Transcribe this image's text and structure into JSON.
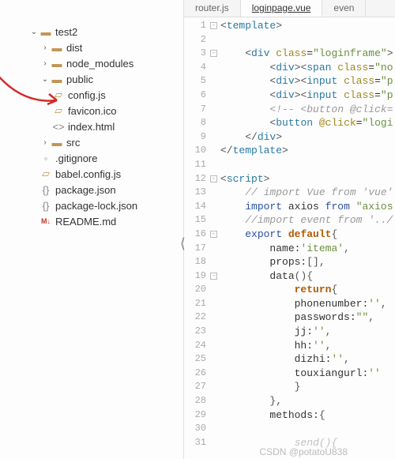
{
  "sidebar": {
    "root": "test2",
    "items": [
      {
        "label": "dist",
        "kind": "folder-closed",
        "twist": "›"
      },
      {
        "label": "node_modules",
        "kind": "folder-closed",
        "twist": "›"
      },
      {
        "label": "public",
        "kind": "folder-open",
        "twist": "⌄"
      }
    ],
    "public_children": [
      {
        "label": "config.js",
        "kind": "file-js"
      },
      {
        "label": "favicon.ico",
        "kind": "file-generic"
      },
      {
        "label": "index.html",
        "kind": "file-generic"
      }
    ],
    "after_public": [
      {
        "label": "src",
        "kind": "folder-closed",
        "twist": "›"
      }
    ],
    "root_files": [
      {
        "label": ".gitignore",
        "kind": "file-generic"
      },
      {
        "label": "babel.config.js",
        "kind": "file-js"
      },
      {
        "label": "package.json",
        "kind": "file-generic"
      },
      {
        "label": "package-lock.json",
        "kind": "file-generic"
      },
      {
        "label": "README.md",
        "kind": "file-md"
      }
    ]
  },
  "tabs": [
    {
      "label": "router.js",
      "active": false
    },
    {
      "label": "loginpage.vue",
      "active": true
    },
    {
      "label": "even",
      "active": false
    }
  ],
  "watermark": "CSDN @potatoU838",
  "code_lines": [
    {
      "n": 1,
      "fold": "-",
      "html": "<span class='punct'>&lt;</span><span class='tag'>template</span><span class='punct'>&gt;</span>"
    },
    {
      "n": 2,
      "html": ""
    },
    {
      "n": 3,
      "fold": "-",
      "html": "    <span class='punct'>&lt;</span><span class='tag'>div</span> <span class='attr'>class</span>=<span class='str'>\"loginframe\"</span><span class='punct'>&gt;</span>"
    },
    {
      "n": 4,
      "html": "        <span class='punct'>&lt;</span><span class='tag'>div</span><span class='punct'>&gt;&lt;</span><span class='tag'>span</span> <span class='attr'>class</span>=<span class='str'>\"no</span>"
    },
    {
      "n": 5,
      "html": "        <span class='punct'>&lt;</span><span class='tag'>div</span><span class='punct'>&gt;&lt;</span><span class='tag'>input</span> <span class='attr'>class</span>=<span class='str'>\"p</span>"
    },
    {
      "n": 6,
      "html": "        <span class='punct'>&lt;</span><span class='tag'>div</span><span class='punct'>&gt;&lt;</span><span class='tag'>input</span> <span class='attr'>class</span>=<span class='str'>\"p</span>"
    },
    {
      "n": 7,
      "html": "        <span class='cmt'>&lt;!-- &lt;button @click=</span>"
    },
    {
      "n": 8,
      "html": "        <span class='punct'>&lt;</span><span class='tag'>button</span> <span class='attr'>@click</span>=<span class='str'>\"logi</span>"
    },
    {
      "n": 9,
      "html": "    <span class='punct'>&lt;/</span><span class='tag'>div</span><span class='punct'>&gt;</span>"
    },
    {
      "n": 10,
      "html": "<span class='punct'>&lt;/</span><span class='tag'>template</span><span class='punct'>&gt;</span>"
    },
    {
      "n": 11,
      "html": ""
    },
    {
      "n": 12,
      "fold": "-",
      "html": "<span class='punct'>&lt;</span><span class='tag'>script</span><span class='punct'>&gt;</span>"
    },
    {
      "n": 13,
      "html": "    <span class='cmt'>// import Vue from 'vue'</span>"
    },
    {
      "n": 14,
      "html": "    <span class='kw2'>import</span> <span class='txt'>axios</span> <span class='kw2'>from</span> <span class='str'>\"axios</span>"
    },
    {
      "n": 15,
      "html": "    <span class='cmt'>//import event from '../</span>"
    },
    {
      "n": 16,
      "fold": "-",
      "html": "    <span class='kw2'>export</span> <span class='kw'>default</span><span class='punct'>{</span>"
    },
    {
      "n": 17,
      "html": "        <span class='txt'>name:</span><span class='str'>'itema'</span><span class='punct'>,</span>"
    },
    {
      "n": 18,
      "html": "        <span class='txt'>props:</span><span class='punct'>[],</span>"
    },
    {
      "n": 19,
      "fold": "-",
      "html": "        <span class='txt'>data</span><span class='punct'>(){</span>"
    },
    {
      "n": 20,
      "html": "            <span class='kw'>return</span><span class='punct'>{</span>"
    },
    {
      "n": 21,
      "html": "            <span class='txt'>phonenumber:</span><span class='str'>''</span><span class='punct'>,</span>"
    },
    {
      "n": 22,
      "html": "            <span class='txt'>passwords:</span><span class='str'>\"\"</span><span class='punct'>,</span>"
    },
    {
      "n": 23,
      "html": "            <span class='txt'>jj:</span><span class='str'>''</span><span class='punct'>,</span>"
    },
    {
      "n": 24,
      "html": "            <span class='txt'>hh:</span><span class='str'>''</span><span class='punct'>,</span>"
    },
    {
      "n": 25,
      "html": "            <span class='txt'>dizhi:</span><span class='str'>''</span><span class='punct'>,</span>"
    },
    {
      "n": 26,
      "html": "            <span class='txt'>touxiangurl:</span><span class='str'>''</span>"
    },
    {
      "n": 27,
      "html": "            <span class='punct'>}</span>"
    },
    {
      "n": 28,
      "html": "        <span class='punct'>},</span>"
    },
    {
      "n": 29,
      "html": "        <span class='txt'>methods:</span><span class='punct'>{</span>"
    },
    {
      "n": 30,
      "html": ""
    },
    {
      "n": 31,
      "html": "            <span class='cmt' style='opacity:.6'>send(){</span>"
    }
  ]
}
